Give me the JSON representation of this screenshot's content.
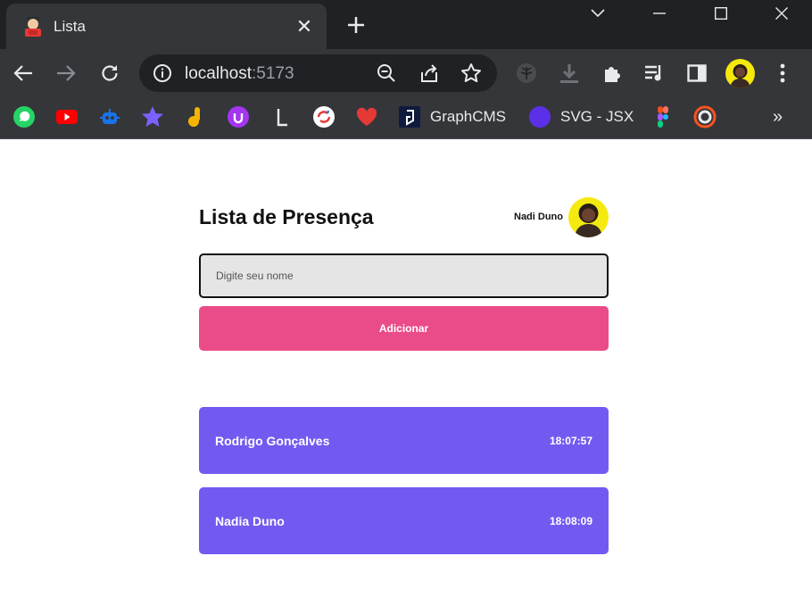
{
  "browser": {
    "tab": {
      "title": "Lista",
      "close_glyph": "✕"
    },
    "url": {
      "host": "localhost",
      "port": ":5173"
    },
    "bookmarks": [
      {
        "name": "whatsapp",
        "label": "",
        "color": "#25d366"
      },
      {
        "name": "youtube",
        "label": "",
        "color": "#ff0000"
      },
      {
        "name": "robot",
        "label": "",
        "color": "#1a73e8"
      },
      {
        "name": "star",
        "label": "",
        "color": "#7b61ff"
      },
      {
        "name": "ajax",
        "label": "",
        "color": "#f4b400"
      },
      {
        "name": "udemy",
        "label": "",
        "color": "#a435f0"
      },
      {
        "name": "typography",
        "label": "",
        "color": "#e8eaed"
      },
      {
        "name": "sync",
        "label": "",
        "color": "#4285f4"
      },
      {
        "name": "heart",
        "label": "",
        "color": "#e53935"
      },
      {
        "name": "graphcms",
        "label": "GraphCMS",
        "color": "#0f1b3d"
      },
      {
        "name": "svg-jsx",
        "label": "SVG - JSX",
        "color": "#5b30e8"
      },
      {
        "name": "figma",
        "label": "",
        "color": "#f24e1e"
      },
      {
        "name": "chromatic",
        "label": "",
        "color": "#fc521f"
      }
    ],
    "more_glyph": "»"
  },
  "app": {
    "title": "Lista de Presença",
    "user": {
      "name": "Nadi Duno"
    },
    "input": {
      "placeholder": "Digite seu nome",
      "value": ""
    },
    "add_button": "Adicionar",
    "students": [
      {
        "name": "Rodrigo Gonçalves",
        "time": "18:07:57"
      },
      {
        "name": "Nadia Duno",
        "time": "18:08:09"
      }
    ]
  },
  "colors": {
    "accent_pink": "#ea4c89",
    "card_purple": "#725af1",
    "avatar_yellow": "#f5ea10"
  }
}
